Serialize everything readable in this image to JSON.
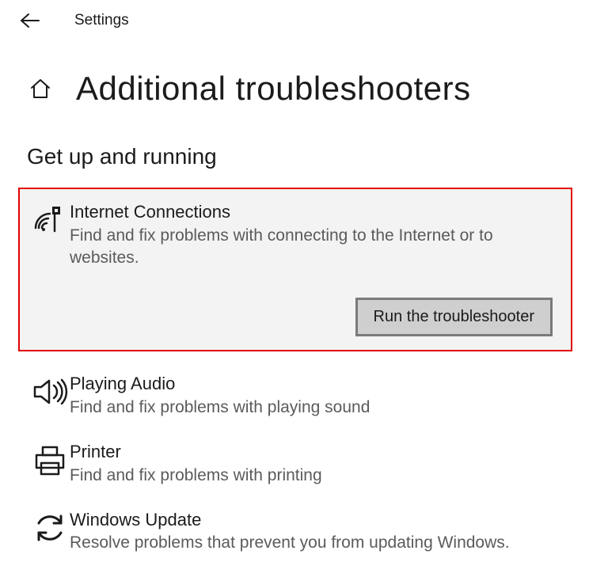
{
  "app": {
    "title": "Settings"
  },
  "page": {
    "title": "Additional troubleshooters"
  },
  "section": {
    "heading": "Get up and running"
  },
  "action": {
    "run_label": "Run the troubleshooter"
  },
  "troubleshooters": [
    {
      "title": "Internet Connections",
      "desc": "Find and fix problems with connecting to the Internet or to websites.",
      "icon": "wireless-icon",
      "selected": true
    },
    {
      "title": "Playing Audio",
      "desc": "Find and fix problems with playing sound",
      "icon": "speaker-icon",
      "selected": false
    },
    {
      "title": "Printer",
      "desc": "Find and fix problems with printing",
      "icon": "printer-icon",
      "selected": false
    },
    {
      "title": "Windows Update",
      "desc": "Resolve problems that prevent you from updating Windows.",
      "icon": "refresh-icon",
      "selected": false
    }
  ],
  "colors": {
    "highlight_border": "#e30000",
    "highlight_bg": "#f3f3f3",
    "button_bg": "#cfcfcf",
    "button_border": "#7a7a7a"
  }
}
